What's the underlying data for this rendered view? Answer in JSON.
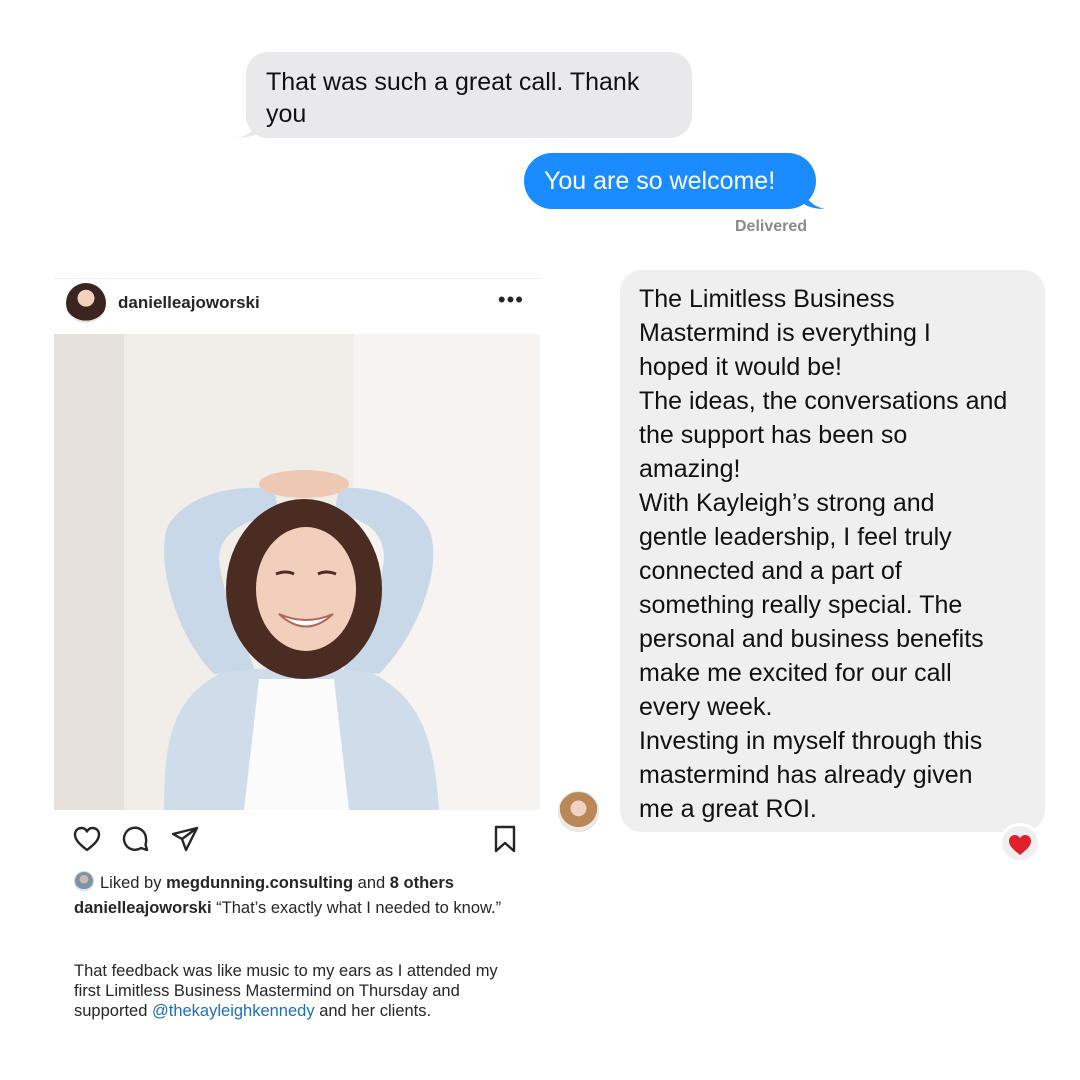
{
  "imessage": {
    "incoming_text": "That was such a great call. Thank you",
    "outgoing_text": "You are so welcome!",
    "status": "Delivered",
    "colors": {
      "incoming": "#e9e9eb",
      "outgoing": "#1a8cff"
    }
  },
  "instagram": {
    "username": "danielleajoworski",
    "more_icon": "ellipsis-icon",
    "photo_icon": "portrait-photo",
    "actions": [
      "heart-icon",
      "comment-icon",
      "share-icon",
      "bookmark-icon"
    ],
    "likes": {
      "prefix": "Liked by",
      "user": "megdunning.consulting",
      "middle": "and",
      "count_text": "8 others"
    },
    "caption": {
      "user": "danielleajoworski",
      "text": "“That’s exactly what I needed to know.”"
    },
    "body": {
      "text_before": "That feedback was like music to my ears as I attended my first Limitless Business Mastermind on Thursday and supported",
      "mention": "@thekayleighkennedy",
      "text_after": "and her clients."
    }
  },
  "testimonial": {
    "lines": [
      "The Limitless Business",
      "Mastermind is everything I",
      "hoped it would be!",
      "The ideas, the conversations and",
      "the support has been so",
      "amazing!",
      "With Kayleigh’s strong and",
      "gentle leadership, I feel truly",
      "connected and a part of",
      "something really special. The",
      "personal and business benefits",
      "make me excited for our call",
      "every week.",
      "Investing in myself through this",
      "mastermind has already given",
      "me a great ROI."
    ],
    "reaction": "heart-reaction-icon",
    "reaction_color": "#e0202a"
  }
}
